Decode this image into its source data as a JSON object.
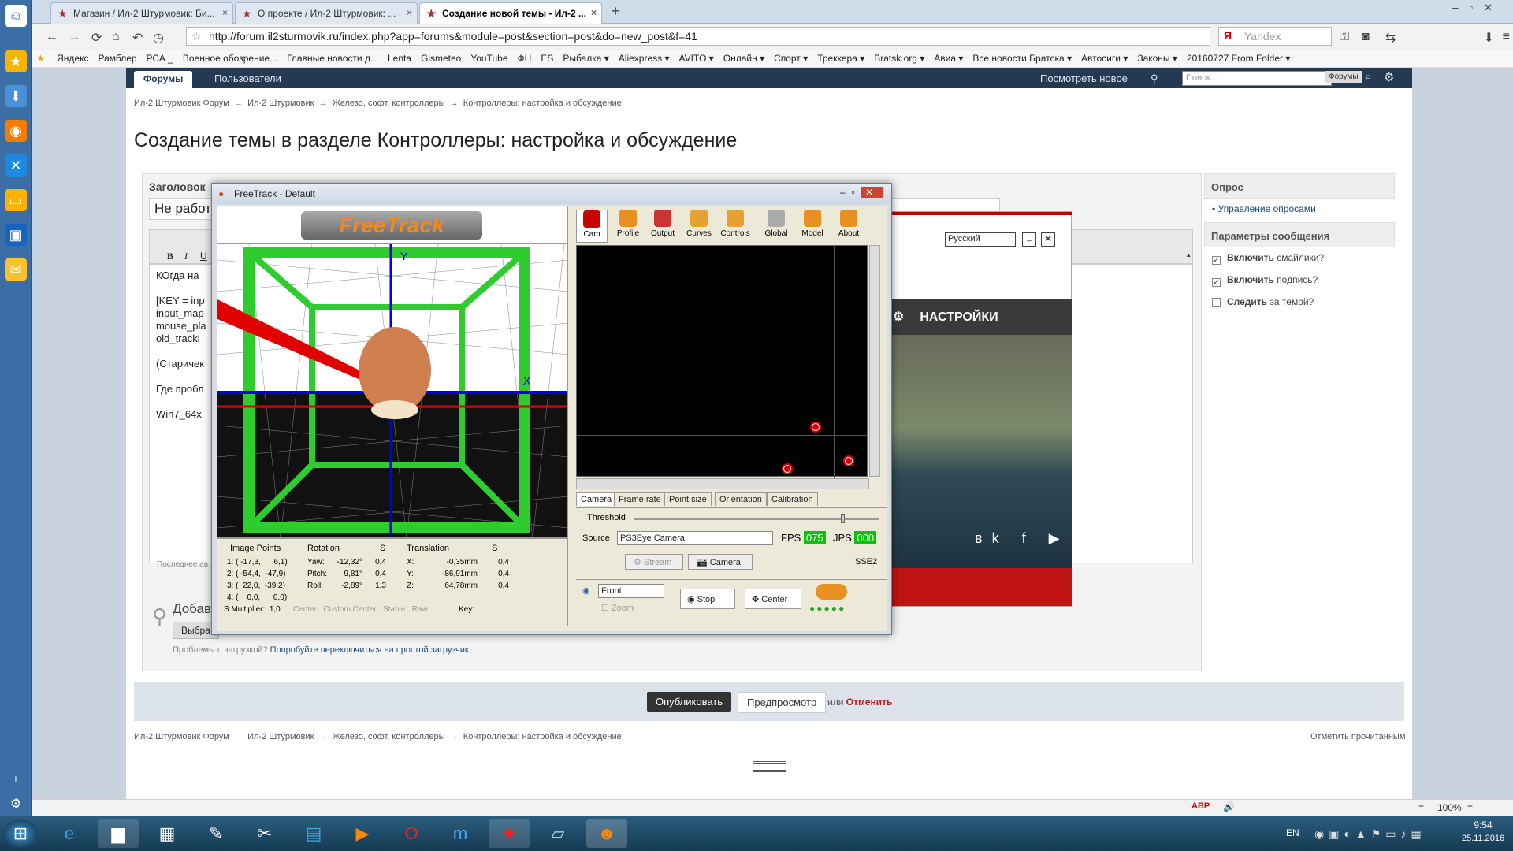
{
  "browser": {
    "tabs": [
      {
        "label": "Магазин / Ил-2 Штурмовик: Би..."
      },
      {
        "label": "О проекте / Ил-2 Штурмовик: ..."
      },
      {
        "label": "Создание новой темы - Ил-2 ..."
      }
    ],
    "url": "http://forum.il2sturmovik.ru/index.php?app=forums&module=post&section=post&do=new_post&f=41",
    "search_placeholder": "Yandex",
    "bookmarks": [
      "Яндекс",
      "Рамблер",
      "РСА _",
      "Военное обозрение...",
      "Главные новости д...",
      "Lenta",
      "Gismeteo",
      "YouTube",
      "ФН",
      "ES",
      "Рыбалка ▾",
      "Aliexpress ▾",
      "AVITO ▾",
      "Онлайн ▾",
      "Спорт ▾",
      "Треккера ▾",
      "Bratsk.org ▾",
      "Авиа ▾",
      "Все новости Братска ▾",
      "Автосиги ▾",
      "Законы ▾",
      "20160727 From Folder ▾"
    ],
    "zoom": "100%"
  },
  "forum": {
    "nav_forums": "Форумы",
    "nav_users": "Пользователи",
    "see_new": "Посмотреть новое",
    "search_placeholder": "Поиск...",
    "search_scope": "Форумы",
    "breadcrumb": [
      "Ил-2 Штурмовик Форум",
      "Ил-2 Штурмовик",
      "Железо, софт, контроллеры",
      "Контроллеры: настройка и обсуждение"
    ],
    "title": "Создание темы в разделе Контроллеры: настройка и обсуждение",
    "header_label": "Заголовок",
    "title_value": "Не работ",
    "editor_text": [
      "КОгда на",
      "",
      "[KEY = inp",
      "input_map",
      "mouse_pla",
      "old_tracki",
      "",
      "(Старичек",
      "",
      "Где пробл",
      "",
      "Win7_64x"
    ],
    "last_saved": "Последнее ав",
    "attach_label": "Добав",
    "choose_button": "Выбра",
    "upload_problem": "Проблемы с загрузкой?",
    "upload_link": "Попробуйте переключиться на простой загрузчик",
    "sidebar": {
      "poll_header": "Опрос",
      "poll_manage": "Управление опросами",
      "params_header": "Параметры сообщения",
      "opt1_bold": "Включить",
      "opt1_rest": "смайлики?",
      "opt2_bold": "Включить",
      "opt2_rest": "подпись?",
      "opt3_bold": "Следить",
      "opt3_rest": "за темой?"
    },
    "publish": "Опубликовать",
    "preview": "Предпросмотр",
    "or": "или",
    "cancel": "Отменить",
    "mark_read": "Отметить прочитанным"
  },
  "game": {
    "lang": "Русский",
    "settings": "НАСТРОЙКИ"
  },
  "freetrack": {
    "title": "FreeTrack - Default",
    "toolbar": [
      "Cam",
      "Profile",
      "Output",
      "Curves",
      "Controls",
      "Global",
      "Model",
      "About"
    ],
    "logo": "FreeTrack",
    "subtabs": [
      "Camera",
      "Frame rate",
      "Point size",
      "Orientation",
      "Calibration"
    ],
    "threshold": "Threshold",
    "source_label": "Source",
    "source_value": "PS3Eye Camera",
    "fps_label": "FPS",
    "fps_value": "075",
    "jps_label": "JPS",
    "jps_value": "000",
    "stream": "Stream",
    "camera": "Camera",
    "sse": "SSE2",
    "view_value": "Front",
    "zoom": "Zoom",
    "stop": "Stop",
    "center": "Center",
    "image_points_header": "Image Points",
    "image_points": [
      "1: ( -17,3,      6,1)",
      "2: ( -54,4,  -47,9)",
      "3: (  22,0,  -39,2)",
      "4: (    0,0,      0,0)"
    ],
    "rotation_header": "Rotation",
    "rotation": [
      {
        "k": "Yaw:",
        "v": "-12,32°",
        "s": "0,4"
      },
      {
        "k": "Pitch:",
        "v": "9,81°",
        "s": "0,4"
      },
      {
        "k": "Roll:",
        "v": "-2,89°",
        "s": "1,3"
      }
    ],
    "translation_header": "Translation",
    "translation": [
      {
        "k": "X:",
        "v": "-0,35mm",
        "s": "0,4"
      },
      {
        "k": "Y:",
        "v": "-86,91mm",
        "s": "0,4"
      },
      {
        "k": "Z:",
        "v": "64,78mm",
        "s": "0,4"
      }
    ],
    "s_header": "S",
    "s_multiplier": "S Multiplier:",
    "s_mult_value": "1,0",
    "opts": [
      "Center",
      "Custom Center",
      "Stable",
      "Raw"
    ],
    "key": "Key:"
  },
  "taskbar": {
    "lang": "EN",
    "time": "9:54",
    "date": "25.11.2016"
  }
}
